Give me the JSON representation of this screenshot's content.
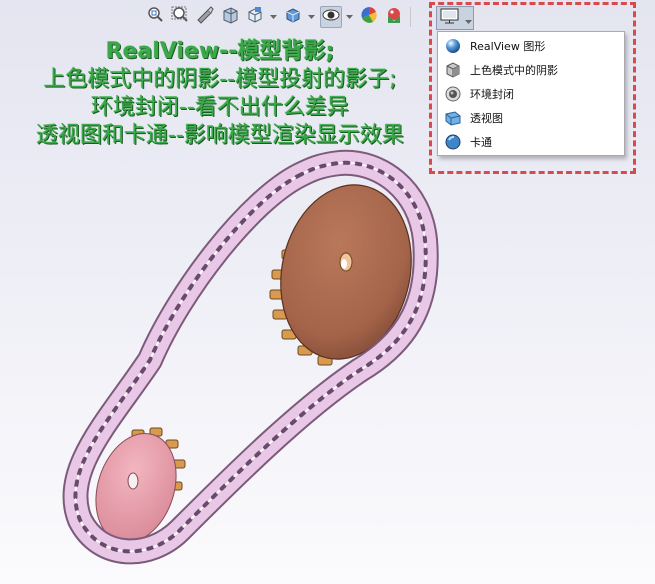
{
  "toolbar": {
    "icons": [
      "zoom-to-fit-icon",
      "zoom-to-area-icon",
      "previous-view-icon",
      "section-view-icon",
      "view-orientation-icon",
      "display-style-icon",
      "hide-show-items-icon",
      "edit-appearance-icon",
      "apply-scene-icon",
      "view-settings-icon"
    ]
  },
  "caption": {
    "line1": "RealView--模型背影;",
    "line2": "上色模式中的阴影--模型投射的影子;",
    "line3": "环境封闭--看不出什么差异",
    "line4": "透视图和卡通--影响模型渲染显示效果"
  },
  "menu": {
    "items": [
      {
        "label": "RealView 图形",
        "icon": "realview-sphere-icon"
      },
      {
        "label": "上色模式中的阴影",
        "icon": "shadows-cube-icon"
      },
      {
        "label": "环境封闭",
        "icon": "ambient-occlusion-icon"
      },
      {
        "label": "透视图",
        "icon": "perspective-icon"
      },
      {
        "label": "卡通",
        "icon": "cartoon-icon"
      }
    ]
  },
  "colors": {
    "caption_green": "#3aa84a",
    "highlight_border": "#d94a4a",
    "large_sprocket": "#a8694c",
    "small_sprocket": "#e79aa6",
    "chain": "#e8c8e6"
  }
}
